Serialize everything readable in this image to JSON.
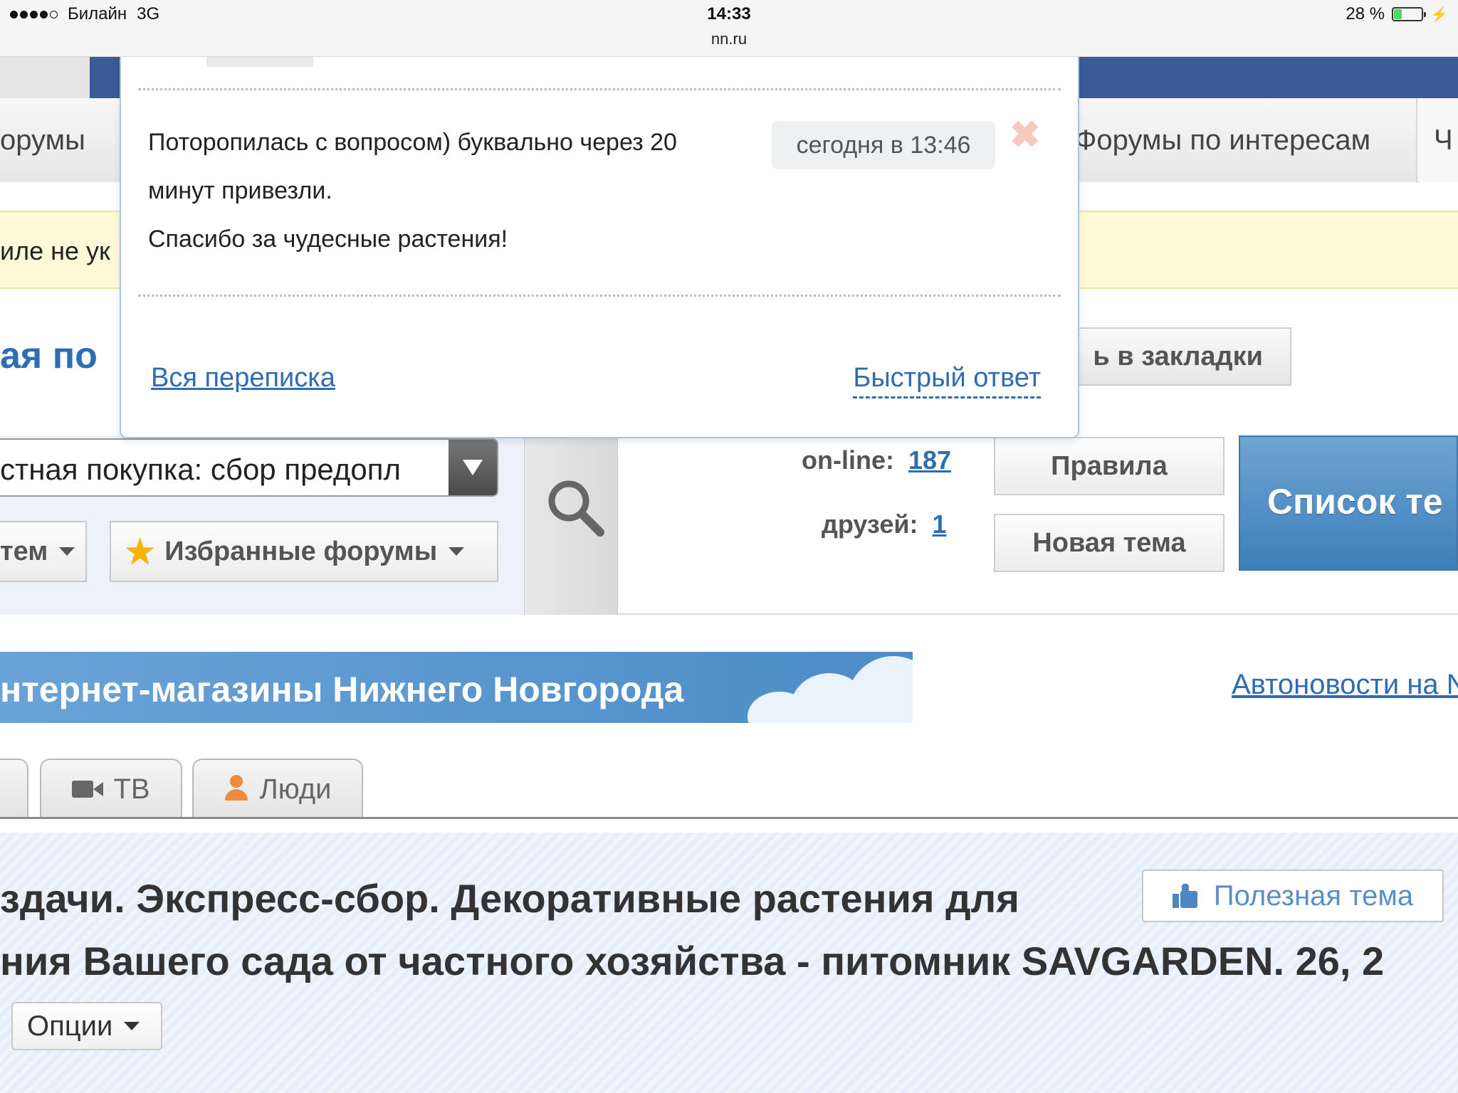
{
  "status_bar": {
    "carrier": "Билайн",
    "network": "3G",
    "time": "14:33",
    "url": "nn.ru",
    "battery_label": "28 %",
    "battery_level": 0.28,
    "battery_color": "#4cd964"
  },
  "nav": {
    "left_partial": "орумы",
    "right_item": "Форумы по интересам",
    "far_partial": "Ч"
  },
  "notice": {
    "text_partial": "иле не ук"
  },
  "page": {
    "title_partial": "ая по",
    "bookmark_button": "ь в закладки"
  },
  "popup": {
    "message_line1": "Поторопилась с вопросом) буквально через 20",
    "message_line2": "минут привезли.",
    "message_line3": "Спасибо за чудесные растения!",
    "timestamp": "сегодня в 13:46",
    "close_icon": "✖",
    "all_correspondence_link": "Вся переписка",
    "quick_reply_link": "Быстрый ответ"
  },
  "controls": {
    "forum_select_value": "стная покупка: сбор предопл",
    "themes_button": "тем",
    "favorites_button": "Избранные форумы",
    "online_label": "on-line:",
    "online_count": "187",
    "friends_label": "друзей:",
    "friends_count": "1",
    "rules_button": "Правила",
    "new_topic_button": "Новая тема",
    "topic_list_button": "Список те",
    "accent_color": "#4d8cc8"
  },
  "banner": {
    "text": "нтернет-магазины Нижнего Новгорода",
    "auto_news_link": "Автоновости на N"
  },
  "tabs": [
    {
      "label": "",
      "icon": "none"
    },
    {
      "label": "ТВ",
      "icon": "video-camera-icon"
    },
    {
      "label": "Люди",
      "icon": "person-icon"
    }
  ],
  "topic": {
    "title_line1": "здачи. Экспресс-сбор. Декоративные растения для",
    "title_line2": "ния Вашего сада от частного хозяйства - питомник SAVGARDEN. 26, 2",
    "useful_button": "Полезная тема",
    "options_button": "Опции"
  }
}
